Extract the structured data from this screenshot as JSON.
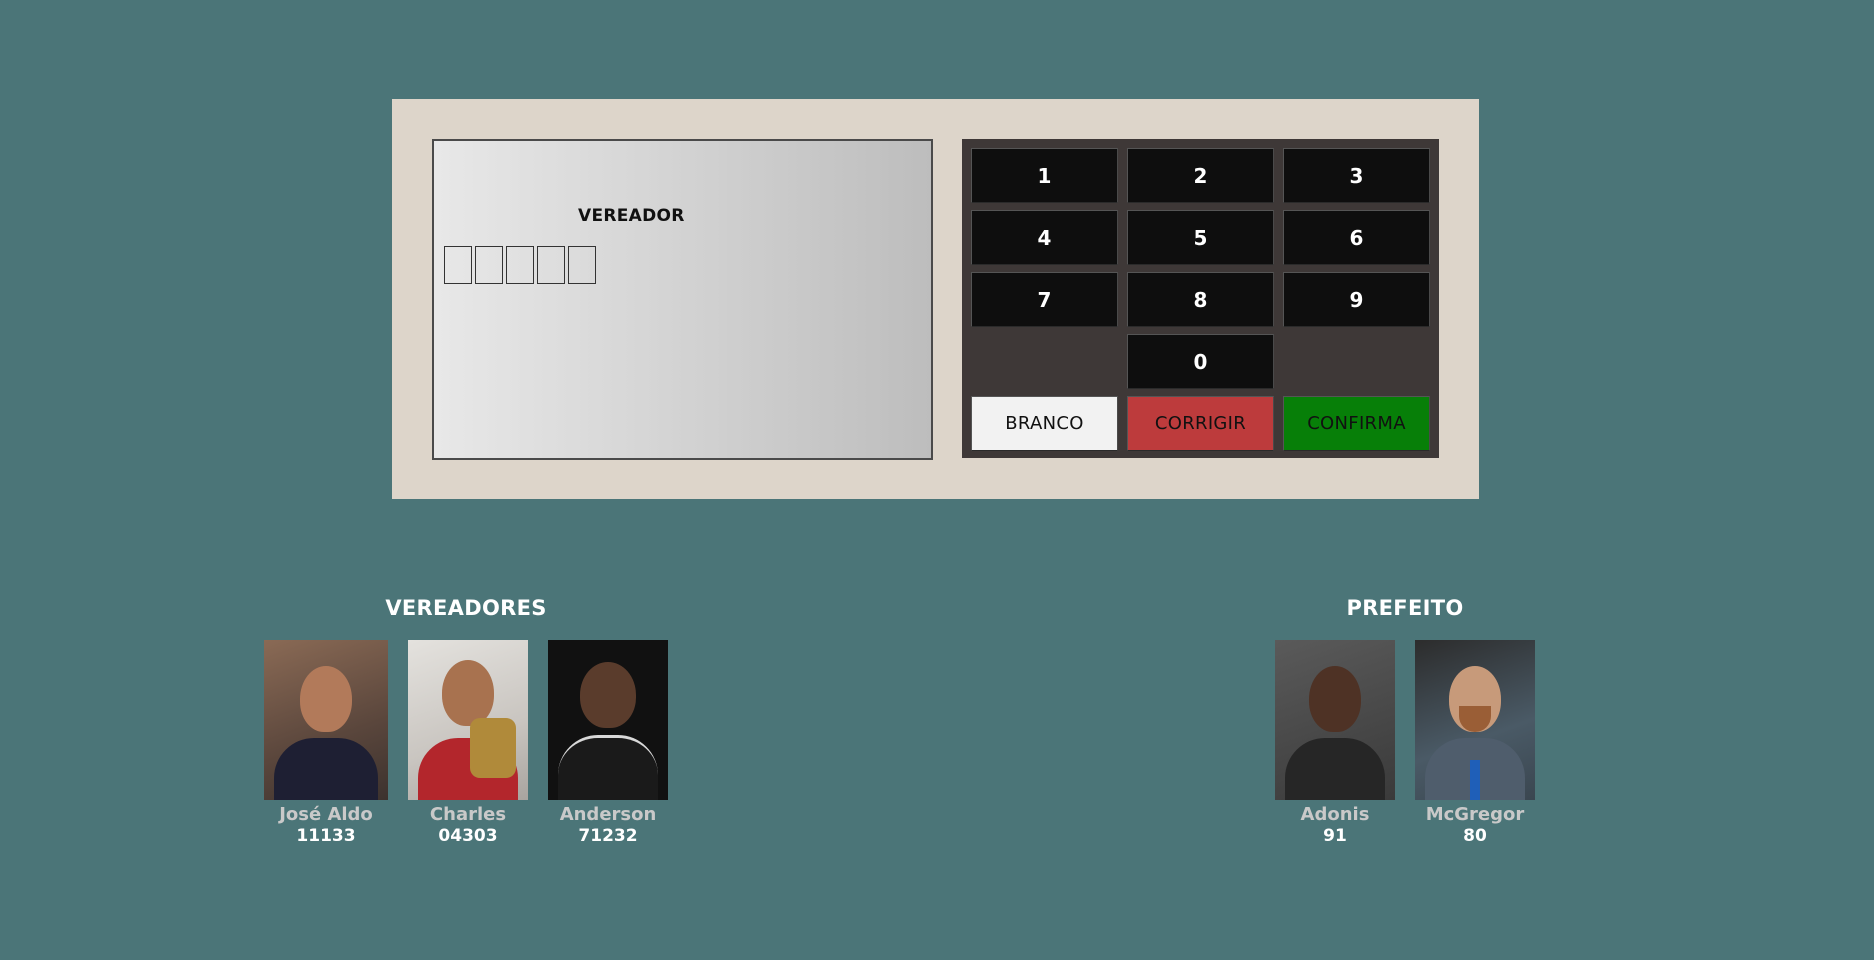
{
  "screen": {
    "title": "VEREADOR",
    "digits": [
      "",
      "",
      "",
      "",
      ""
    ]
  },
  "keypad": {
    "keys": [
      "1",
      "2",
      "3",
      "4",
      "5",
      "6",
      "7",
      "8",
      "9",
      "0"
    ],
    "branco_label": "BRANCO",
    "corrigir_label": "CORRIGIR",
    "confirma_label": "CONFIRMA"
  },
  "vereadores": {
    "title": "VEREADORES",
    "candidates": [
      {
        "name": "José Aldo",
        "number": "11133"
      },
      {
        "name": "Charles",
        "number": "04303"
      },
      {
        "name": "Anderson",
        "number": "71232"
      }
    ]
  },
  "prefeito": {
    "title": "PREFEITO",
    "candidates": [
      {
        "name": "Adonis",
        "number": "91"
      },
      {
        "name": "McGregor",
        "number": "80"
      }
    ]
  },
  "colors": {
    "background": "#4b7578",
    "urna": "#ddd5ca",
    "keypad": "#3e3837",
    "key": "#0e0e0e",
    "branco": "#f2f2f2",
    "corrigir": "#bd3b3c",
    "confirma": "#077f08"
  }
}
